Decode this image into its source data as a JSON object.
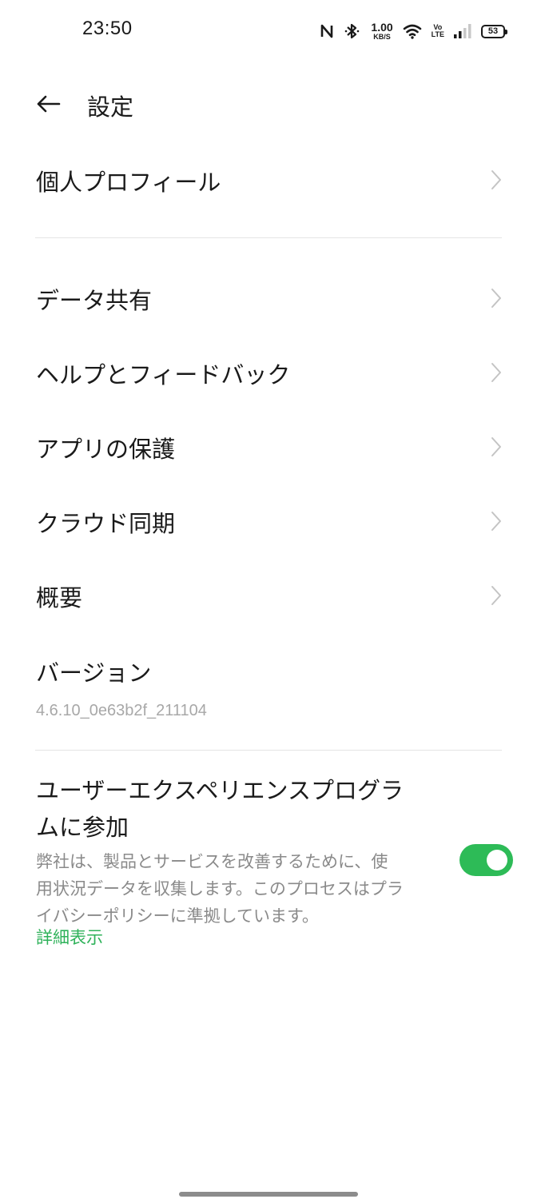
{
  "status_bar": {
    "time": "23:50",
    "net_speed_value": "1.00",
    "net_speed_unit": "KB/S",
    "volte_top": "Vo",
    "volte_bottom": "LTE",
    "battery": "53",
    "icons": [
      "nfc-icon",
      "bluetooth-icon",
      "wifi-icon",
      "signal-icon"
    ]
  },
  "header": {
    "title": "設定",
    "back_icon": "arrow-left-icon"
  },
  "items": {
    "profile": "個人プロフィール",
    "data_sharing": "データ共有",
    "help": "ヘルプとフィードバック",
    "app_protection": "アプリの保護",
    "cloud_sync": "クラウド同期",
    "about": "概要",
    "version_label": "バージョン",
    "version_value": "4.6.10_0e63b2f_211104"
  },
  "ux_program": {
    "title": "ユーザーエクスペリエンスプログラムに参加",
    "description": "弊社は、製品とサービスを改善するために、使用状況データを収集します。このプロセスはプライバシーポリシーに準拠しています。",
    "link": "詳細表示",
    "enabled": true
  },
  "colors": {
    "accent_green": "#2dbb57",
    "link_green": "#2fb25a",
    "text_primary": "#1a1a1a",
    "text_secondary": "#8a8a8a",
    "divider": "#e4e4e4"
  }
}
